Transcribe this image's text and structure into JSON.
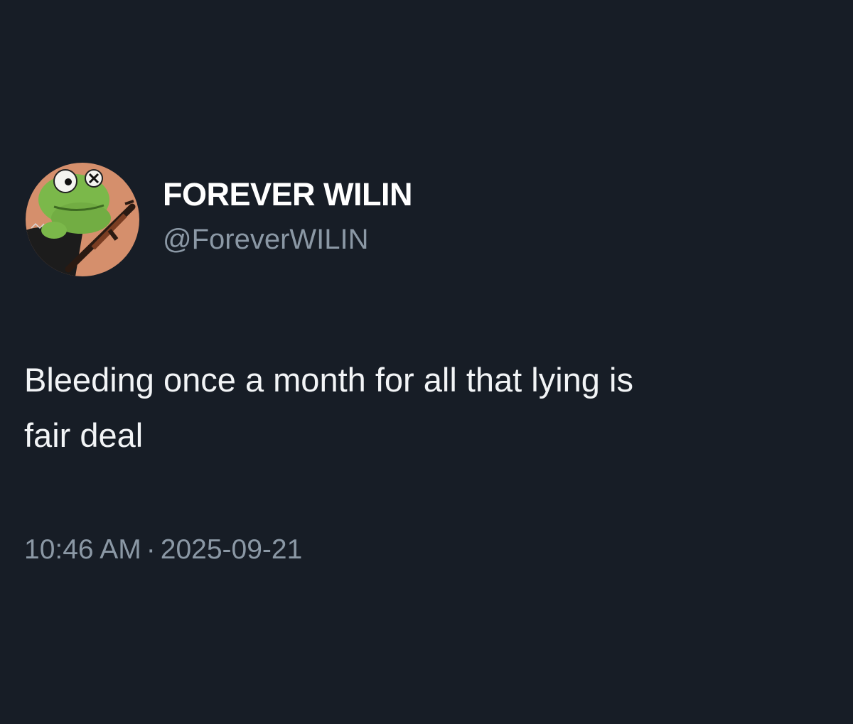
{
  "tweet": {
    "author": {
      "display_name": "FOREVER WILIN",
      "handle": "@ForeverWILIN",
      "avatar_icon": "frog-avatar-icon"
    },
    "text": "Bleeding once a month for all that lying is\nfair deal",
    "time": "10:46 AM",
    "separator": "·",
    "date": "2025-09-21"
  },
  "colors": {
    "background": "#171d26",
    "primary_text": "#ffffff",
    "secondary_text": "#8b98a5",
    "avatar_background": "#d58f6c",
    "frog_green": "#7bb84a"
  }
}
